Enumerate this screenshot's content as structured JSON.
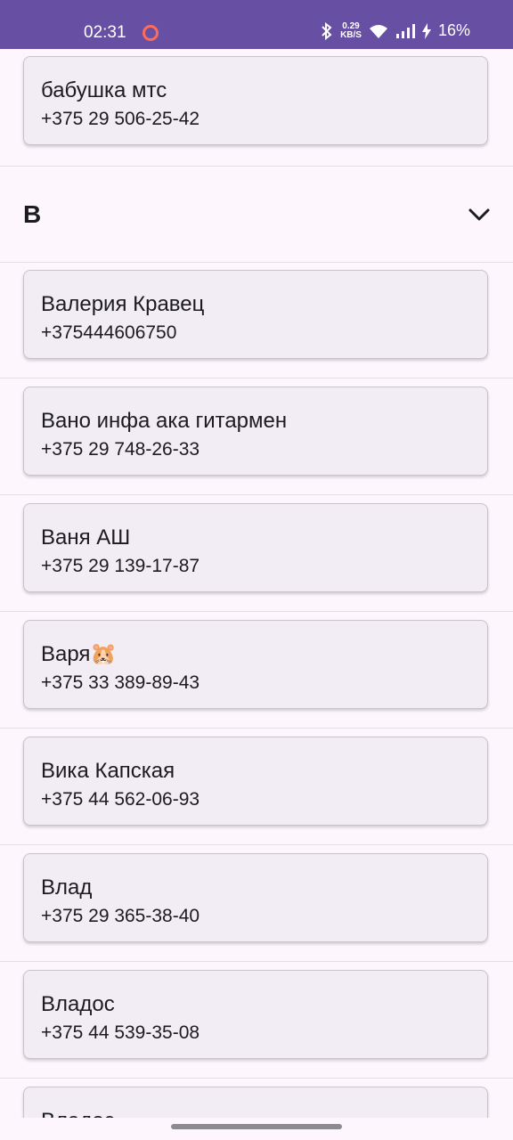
{
  "status_bar": {
    "time": "02:31",
    "net_speed": "0.29",
    "net_unit": "KB/S",
    "battery": "16%"
  },
  "top_contact": {
    "name": "бабушка мтс",
    "phone": "+375 29 506-25-42"
  },
  "section": {
    "letter": "В"
  },
  "contacts": [
    {
      "name": "Валерия Кравец",
      "phone": "+375444606750"
    },
    {
      "name": "Вано инфа ака гитармен",
      "phone": "+375 29 748-26-33"
    },
    {
      "name": "Ваня АШ",
      "phone": "+375 29 139-17-87"
    },
    {
      "name": "Варя🐹",
      "phone": "+375 33 389-89-43"
    },
    {
      "name": "Вика Капская",
      "phone": "+375 44 562-06-93"
    },
    {
      "name": "Влад",
      "phone": "+375 29 365-38-40"
    },
    {
      "name": "Владос",
      "phone": "+375 44 539-35-08"
    },
    {
      "name": "Владос",
      "phone": ""
    }
  ]
}
